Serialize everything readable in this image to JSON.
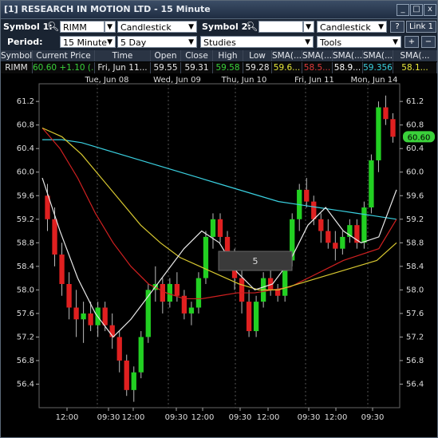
{
  "window": {
    "title": "[1] RESEARCH IN MOTION LTD - 15 Minute",
    "buttons": {
      "minimize": "_",
      "maximize": "□",
      "close": "x"
    }
  },
  "toolbar1": {
    "symbol1_label": "Symbol 1:",
    "symbol1_value": "RIMM",
    "chart_type": "Candlestick",
    "symbol2_label": "Symbol 2:",
    "symbol2_value": "",
    "chart_type2": "Candlestick",
    "help": "?",
    "link": "Link 1"
  },
  "toolbar2": {
    "period_label": "Period:",
    "interval": "15 Minute",
    "range": "5 Day",
    "studies": "Studies",
    "tools": "Tools"
  },
  "quote": {
    "headers": [
      "Symbol",
      "Current Price",
      "Time",
      "Open",
      "Close",
      "High",
      "Low",
      "SMA(...",
      "SMA(...",
      "SMA(...",
      "SMA(...",
      "SMA(..."
    ],
    "values": [
      "RIMM",
      "60.60 +1.10 (...",
      "Fri, Jun 11...",
      "59.55",
      "59.31",
      "59.58",
      "59.28",
      "59.6...",
      "58.5...",
      "58.9...",
      "59.356",
      "58.1..."
    ],
    "colors": {
      "up": "#3ad13a",
      "sma_yellow": "#e8e83a",
      "sma_red": "#e03a3a",
      "sma_cyan": "#3ad0e0",
      "white": "#ffffff"
    }
  },
  "chart_data": {
    "type": "candlestick",
    "date_labels": [
      "Tue, Jun 08",
      "Wed, Jun 09",
      "Thu, Jun 10",
      "Fri, Jun 11",
      "Mon, Jun 14"
    ],
    "x_tick_labels": [
      "12:00",
      "09:30",
      "12:00",
      "09:30",
      "12:00",
      "09:30",
      "12:00",
      "09:30",
      "12:00",
      "09:30"
    ],
    "y_ticks": [
      56.4,
      56.8,
      57.2,
      57.6,
      58.0,
      58.4,
      58.8,
      59.2,
      59.6,
      60.0,
      60.4,
      60.8,
      61.2
    ],
    "ylim": [
      56.0,
      61.5
    ],
    "current_price_tag": "60.60",
    "overlay_label": "5",
    "candles": [
      [
        59.6,
        59.8,
        59.0,
        59.2
      ],
      [
        59.2,
        59.4,
        58.4,
        58.6
      ],
      [
        58.6,
        58.8,
        57.9,
        58.1
      ],
      [
        58.1,
        58.3,
        57.5,
        57.7
      ],
      [
        57.7,
        58.0,
        57.2,
        57.5
      ],
      [
        57.5,
        57.8,
        57.1,
        57.6
      ],
      [
        57.6,
        57.8,
        57.3,
        57.4
      ],
      [
        57.4,
        57.8,
        57.2,
        57.7
      ],
      [
        57.7,
        57.8,
        57.3,
        57.4
      ],
      [
        57.4,
        57.6,
        57.0,
        57.2
      ],
      [
        57.2,
        57.3,
        56.6,
        56.8
      ],
      [
        56.8,
        56.9,
        56.2,
        56.3
      ],
      [
        56.3,
        56.7,
        56.1,
        56.6
      ],
      [
        56.6,
        57.3,
        56.5,
        57.2
      ],
      [
        57.2,
        58.1,
        57.1,
        58.0
      ],
      [
        58.0,
        58.4,
        57.8,
        58.1
      ],
      [
        58.1,
        58.2,
        57.6,
        57.8
      ],
      [
        57.8,
        58.2,
        57.7,
        58.1
      ],
      [
        58.1,
        58.3,
        57.8,
        57.9
      ],
      [
        57.9,
        58.0,
        57.5,
        57.6
      ],
      [
        57.6,
        57.8,
        57.4,
        57.7
      ],
      [
        57.7,
        58.3,
        57.6,
        58.2
      ],
      [
        58.2,
        59.0,
        58.1,
        58.9
      ],
      [
        58.9,
        59.3,
        58.7,
        59.2
      ],
      [
        59.2,
        59.3,
        58.8,
        58.9
      ],
      [
        58.9,
        59.0,
        58.5,
        58.6
      ],
      [
        58.6,
        58.7,
        58.0,
        58.2
      ],
      [
        58.2,
        58.4,
        57.6,
        57.8
      ],
      [
        57.8,
        58.0,
        57.2,
        57.3
      ],
      [
        57.3,
        57.9,
        57.2,
        57.8
      ],
      [
        57.8,
        58.3,
        57.7,
        58.2
      ],
      [
        58.2,
        58.4,
        57.9,
        58.0
      ],
      [
        58.0,
        58.1,
        57.8,
        57.9
      ],
      [
        57.9,
        58.6,
        57.8,
        58.5
      ],
      [
        58.5,
        59.3,
        58.4,
        59.2
      ],
      [
        59.2,
        59.8,
        59.0,
        59.7
      ],
      [
        59.7,
        59.9,
        59.4,
        59.5
      ],
      [
        59.5,
        59.6,
        59.1,
        59.2
      ],
      [
        59.2,
        59.3,
        58.8,
        59.0
      ],
      [
        59.0,
        59.2,
        58.7,
        58.8
      ],
      [
        58.8,
        59.0,
        58.5,
        58.7
      ],
      [
        58.7,
        59.0,
        58.6,
        58.9
      ],
      [
        58.9,
        59.2,
        58.8,
        59.1
      ],
      [
        59.1,
        59.2,
        58.7,
        58.8
      ],
      [
        58.8,
        59.5,
        58.7,
        59.4
      ],
      [
        59.4,
        60.3,
        59.3,
        60.2
      ],
      [
        60.2,
        61.2,
        60.0,
        61.1
      ],
      [
        61.1,
        61.3,
        60.8,
        60.9
      ],
      [
        60.9,
        61.0,
        60.5,
        60.6
      ]
    ],
    "series": [
      {
        "name": "SMA cyan",
        "color": "#3ad0e0",
        "values": [
          60.55,
          60.55,
          60.5,
          60.4,
          60.3,
          60.2,
          60.1,
          60.0,
          59.9,
          59.8,
          59.7,
          59.6,
          59.5,
          59.45,
          59.4,
          59.35,
          59.3,
          59.25,
          59.2
        ]
      },
      {
        "name": "SMA red",
        "color": "#d02020",
        "values": [
          60.75,
          60.4,
          59.9,
          59.3,
          58.8,
          58.4,
          58.1,
          57.95,
          57.85,
          57.85,
          57.9,
          57.95,
          57.95,
          58.0,
          58.05,
          58.2,
          58.35,
          58.5,
          58.6,
          58.7,
          59.2
        ]
      },
      {
        "name": "SMA yellow",
        "color": "#d8c830",
        "values": [
          60.75,
          60.6,
          60.3,
          59.9,
          59.5,
          59.1,
          58.8,
          58.55,
          58.4,
          58.25,
          58.1,
          58.0,
          58.0,
          58.1,
          58.2,
          58.3,
          58.4,
          58.5,
          58.8
        ]
      },
      {
        "name": "SMA white",
        "color": "#e8e8e8",
        "values": [
          59.9,
          59.0,
          58.2,
          57.6,
          57.2,
          57.5,
          57.9,
          58.3,
          58.7,
          59.0,
          58.8,
          58.3,
          58.0,
          58.1,
          58.5,
          59.1,
          59.4,
          59.0,
          58.8,
          58.9,
          59.7
        ]
      }
    ]
  }
}
